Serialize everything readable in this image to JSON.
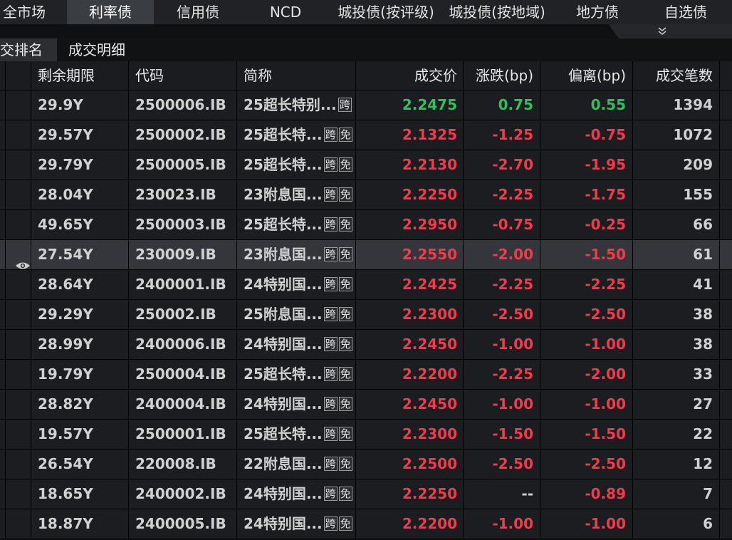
{
  "top_tabs": [
    {
      "label": "全市场",
      "active": false
    },
    {
      "label": "利率债",
      "active": true
    },
    {
      "label": "信用债",
      "active": false
    },
    {
      "label": "NCD",
      "active": false
    },
    {
      "label": "城投债(按评级)",
      "active": false
    },
    {
      "label": "城投债(按地域)",
      "active": false
    },
    {
      "label": "地方债",
      "active": false
    },
    {
      "label": "自选债",
      "active": false
    }
  ],
  "more_icon": "double-chevron-down-icon",
  "sub_tabs": [
    {
      "label": "交排名",
      "active": true
    },
    {
      "label": "成交明细",
      "active": false
    }
  ],
  "columns": {
    "remaining": "剩余期限",
    "code": "代码",
    "name": "简称",
    "price": "成交价",
    "change": "涨跌(bp)",
    "deviation": "偏离(bp)",
    "count": "成交笔数"
  },
  "colors": {
    "up": "#2fc25b",
    "down": "#f23a4a",
    "selected_row": "#34363b"
  },
  "rows": [
    {
      "remaining": "29.9Y",
      "code": "2500006.IB",
      "name": "25超长特别...",
      "tags": [
        "跨"
      ],
      "price": "2.2475",
      "change": "0.75",
      "deviation": "0.55",
      "count": "1394",
      "dir": "up"
    },
    {
      "remaining": "29.57Y",
      "code": "2500002.IB",
      "name": "25超长特...",
      "tags": [
        "跨",
        "免"
      ],
      "price": "2.1325",
      "change": "-1.25",
      "deviation": "-0.75",
      "count": "1072",
      "dir": "down"
    },
    {
      "remaining": "29.79Y",
      "code": "2500005.IB",
      "name": "25超长特...",
      "tags": [
        "跨",
        "免"
      ],
      "price": "2.2130",
      "change": "-2.70",
      "deviation": "-1.95",
      "count": "209",
      "dir": "down"
    },
    {
      "remaining": "28.04Y",
      "code": "230023.IB",
      "name": "23附息国...",
      "tags": [
        "跨",
        "免"
      ],
      "price": "2.2250",
      "change": "-2.25",
      "deviation": "-1.75",
      "count": "155",
      "dir": "down"
    },
    {
      "remaining": "49.65Y",
      "code": "2500003.IB",
      "name": "25超长特...",
      "tags": [
        "跨",
        "免"
      ],
      "price": "2.2950",
      "change": "-0.75",
      "deviation": "-0.25",
      "count": "66",
      "dir": "down"
    },
    {
      "remaining": "27.54Y",
      "code": "230009.IB",
      "name": "23附息国...",
      "tags": [
        "跨",
        "免"
      ],
      "price": "2.2550",
      "change": "-2.00",
      "deviation": "-1.50",
      "count": "61",
      "dir": "down",
      "selected": true,
      "watch": true
    },
    {
      "remaining": "28.64Y",
      "code": "2400001.IB",
      "name": "24特别国...",
      "tags": [
        "跨",
        "免"
      ],
      "price": "2.2425",
      "change": "-2.25",
      "deviation": "-2.25",
      "count": "41",
      "dir": "down"
    },
    {
      "remaining": "29.29Y",
      "code": "250002.IB",
      "name": "25附息国...",
      "tags": [
        "跨",
        "免"
      ],
      "price": "2.2300",
      "change": "-2.50",
      "deviation": "-2.50",
      "count": "38",
      "dir": "down"
    },
    {
      "remaining": "28.99Y",
      "code": "2400006.IB",
      "name": "24特别国...",
      "tags": [
        "跨",
        "免"
      ],
      "price": "2.2450",
      "change": "-1.00",
      "deviation": "-1.00",
      "count": "38",
      "dir": "down"
    },
    {
      "remaining": "19.79Y",
      "code": "2500004.IB",
      "name": "25超长特...",
      "tags": [
        "跨",
        "免"
      ],
      "price": "2.2200",
      "change": "-2.25",
      "deviation": "-2.00",
      "count": "33",
      "dir": "down"
    },
    {
      "remaining": "28.82Y",
      "code": "2400004.IB",
      "name": "24特别国...",
      "tags": [
        "跨",
        "免"
      ],
      "price": "2.2450",
      "change": "-1.00",
      "deviation": "-1.00",
      "count": "27",
      "dir": "down"
    },
    {
      "remaining": "19.57Y",
      "code": "2500001.IB",
      "name": "25超长特...",
      "tags": [
        "跨",
        "免"
      ],
      "price": "2.2300",
      "change": "-1.50",
      "deviation": "-1.50",
      "count": "22",
      "dir": "down"
    },
    {
      "remaining": "26.54Y",
      "code": "220008.IB",
      "name": "22附息国...",
      "tags": [
        "跨",
        "免"
      ],
      "price": "2.2500",
      "change": "-2.50",
      "deviation": "-2.50",
      "count": "12",
      "dir": "down"
    },
    {
      "remaining": "18.65Y",
      "code": "2400002.IB",
      "name": "24特别国...",
      "tags": [
        "跨",
        "免"
      ],
      "price": "2.2250",
      "change": "--",
      "deviation": "-0.89",
      "count": "7",
      "dir": "down",
      "change_flat": true
    },
    {
      "remaining": "18.87Y",
      "code": "2400005.IB",
      "name": "24特别国...",
      "tags": [
        "跨",
        "免"
      ],
      "price": "2.2200",
      "change": "-1.00",
      "deviation": "-1.00",
      "count": "6",
      "dir": "down"
    }
  ]
}
